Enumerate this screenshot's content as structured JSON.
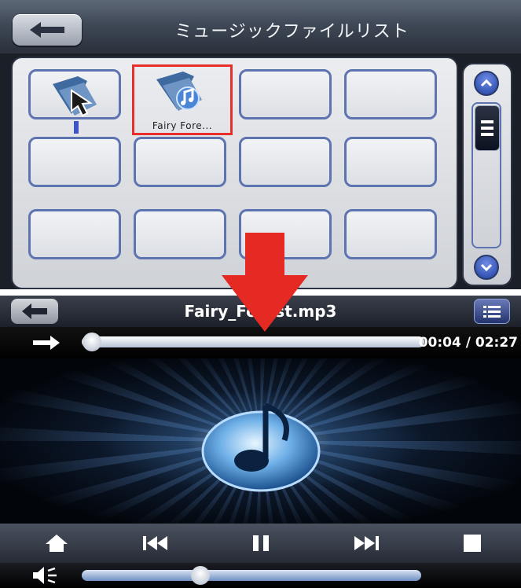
{
  "browser": {
    "title": "ミュージックファイルリスト",
    "files": [
      {
        "label": "",
        "icon": "folder-up-icon"
      },
      {
        "label": "Fairy  Fore...",
        "icon": "music-folder-icon",
        "selected": true
      }
    ],
    "highlight_color": "#e8302a"
  },
  "player": {
    "title": "Fairy_Forest.mp3",
    "time": "00:04 / 02:27",
    "progress": 0.03,
    "volume": 0.35
  },
  "colors": {
    "accent_blue": "#5d74b0",
    "arrow_red": "#e52a24"
  }
}
